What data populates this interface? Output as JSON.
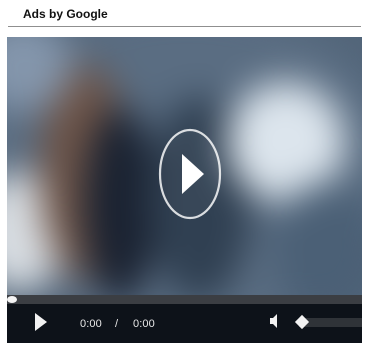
{
  "ad": {
    "label": "Ads by Google"
  },
  "player": {
    "current_time": "0:00",
    "time_separator": "/",
    "duration": "0:00",
    "progress": 0,
    "volume": 0,
    "icons": {
      "center_play": "play-circle-icon",
      "control_play": "play-icon",
      "volume": "volume-icon",
      "volume_slider": "volume-slider-knob"
    }
  },
  "colors": {
    "header_text": "#111111",
    "header_divider": "#8f8f8f",
    "controls_background": "#0d1219",
    "progress_track": "#3b3e43",
    "volume_track": "#2f3338",
    "control_icons": "#f2f2f2"
  }
}
